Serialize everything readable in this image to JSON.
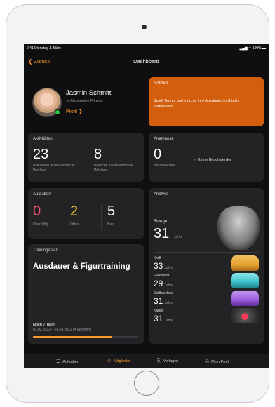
{
  "status": {
    "time": "9:41  Dienstag 1. März",
    "battery": "100%"
  },
  "nav": {
    "back": "Zurück",
    "title": "Dashboard"
  },
  "profile": {
    "name": "Jasmin Schmitt",
    "category": "Allgemeine Fitness",
    "link": "Profil"
  },
  "notes": {
    "title": "Notizen",
    "text": "Spielt Tennis und möchte ihre Ausdauer im Studio verbessern"
  },
  "activities": {
    "title": "Aktivitäten",
    "value1": "23",
    "label1": "Aktivitäten in den letzten 4 Wochen",
    "value2": "8",
    "label2": "Besuche in den letzten 4 Wochen"
  },
  "anamnese": {
    "title": "Anamnese",
    "value": "0",
    "label": "Beschwerden",
    "status": "Keine Beschwerden"
  },
  "tasks": {
    "title": "Aufgaben",
    "items": [
      {
        "value": "0",
        "label": "Überfällig",
        "color": "#ff4f6d"
      },
      {
        "value": "2",
        "label": "Offen",
        "color": "#ffcc2e"
      },
      {
        "value": "5",
        "label": "Bald",
        "color": "#ffffff"
      }
    ]
  },
  "training": {
    "title": "Trainingsplan",
    "name": "Ausdauer & Figurtraining",
    "remaining": "Noch 7 Tage",
    "range": "02.03.2022 – 01.04.2022 (4 Wochen)",
    "progress": 0.75
  },
  "analyse": {
    "title": "Analyse",
    "bioage_label": "BioAge",
    "bioage_value": "31",
    "unit": "Jahre",
    "rows": [
      {
        "label": "Kraft",
        "value": "33",
        "color": "#e7a232"
      },
      {
        "label": "Flexibilität",
        "value": "29",
        "color": "#3cc0c9"
      },
      {
        "label": "Stoffwechsel",
        "value": "31",
        "color": "#9b5de0"
      },
      {
        "label": "Kardio",
        "value": "31",
        "color": "#d63a5e"
      }
    ]
  },
  "tabs": [
    {
      "label": "Aufgaben",
      "icon": "checklist-icon",
      "active": false
    },
    {
      "label": "Mitglieder",
      "icon": "members-icon",
      "active": true
    },
    {
      "label": "Vorlagen",
      "icon": "templates-icon",
      "active": false
    },
    {
      "label": "Mein Profil",
      "icon": "profile-icon",
      "active": false
    }
  ],
  "colors": {
    "accent": "#ff9a2e",
    "notes_bg": "#d35f0e"
  }
}
